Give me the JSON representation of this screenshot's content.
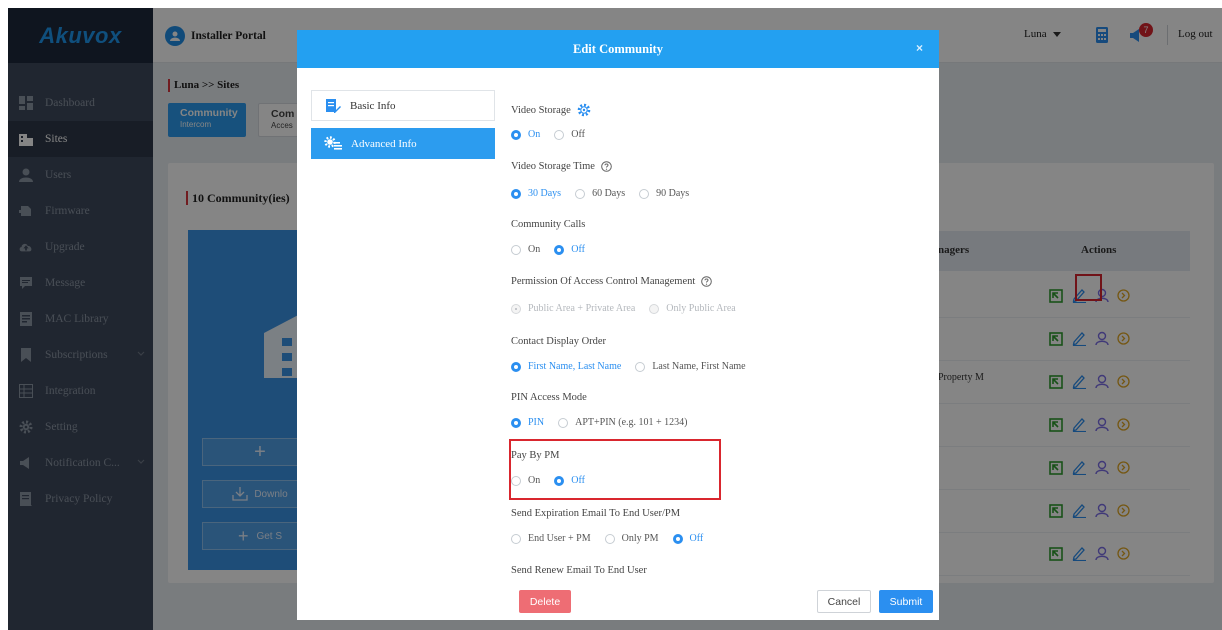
{
  "brand": "Akuvox",
  "sidebar": {
    "items": [
      {
        "label": "Dashboard",
        "icon": "dashboard-icon"
      },
      {
        "label": "Sites",
        "icon": "building-icon",
        "active": true
      },
      {
        "label": "Users",
        "icon": "user-icon"
      },
      {
        "label": "Firmware",
        "icon": "firmware-icon"
      },
      {
        "label": "Upgrade",
        "icon": "cloud-upload-icon"
      },
      {
        "label": "Message",
        "icon": "message-icon"
      },
      {
        "label": "MAC Library",
        "icon": "library-icon"
      },
      {
        "label": "Subscriptions",
        "icon": "bookmark-icon"
      },
      {
        "label": "Integration",
        "icon": "grid-icon"
      },
      {
        "label": "Setting",
        "icon": "gear-icon"
      },
      {
        "label": "Notification C...",
        "icon": "megaphone-icon"
      },
      {
        "label": "Privacy Policy",
        "icon": "document-icon"
      }
    ]
  },
  "header": {
    "portal_title": "Installer Portal",
    "username": "Luna",
    "notification_count": "7",
    "logout": "Log out"
  },
  "background": {
    "breadcrumb": "Luna >> Sites",
    "tab1": {
      "title": "Community",
      "subtitle": "Intercom"
    },
    "tab2": {
      "title": "Com",
      "subtitle": "Acces"
    },
    "community_count": "10 Community(ies)",
    "plus": "+",
    "download_label": "Downlo",
    "get_started_label": "Get S",
    "columns": {
      "managers": "nagers",
      "actions": "Actions"
    },
    "property_manager_text": "Property M"
  },
  "modal": {
    "title": "Edit Community",
    "close": "×",
    "side_basic": "Basic Info",
    "side_advanced": "Advanced Info",
    "sections": {
      "video_storage": {
        "label": "Video Storage",
        "on": "On",
        "off": "Off",
        "selected": "On"
      },
      "video_storage_time": {
        "label": "Video Storage Time",
        "opt1": "30 Days",
        "opt2": "60 Days",
        "opt3": "90 Days",
        "selected": "30 Days"
      },
      "community_calls": {
        "label": "Community Calls",
        "on": "On",
        "off": "Off",
        "selected": "Off"
      },
      "permission": {
        "label": "Permission Of Access Control Management",
        "opt1": "Public Area + Private Area",
        "opt2": "Only Public Area",
        "selected": "Public Area + Private Area"
      },
      "contact_order": {
        "label": "Contact Display Order",
        "opt1": "First Name, Last Name",
        "opt2": "Last Name, First Name",
        "selected": "First Name, Last Name"
      },
      "pin_mode": {
        "label": "PIN Access Mode",
        "opt1": "PIN",
        "opt2": "APT+PIN (e.g. 101 + 1234)",
        "selected": "PIN"
      },
      "pay_by_pm": {
        "label": "Pay By PM",
        "on": "On",
        "off": "Off",
        "selected": "Off"
      },
      "expiration_email": {
        "label": "Send Expiration Email To End User/PM",
        "opt1": "End User + PM",
        "opt2": "Only PM",
        "opt3": "Off",
        "selected": "Off"
      },
      "renew_email": {
        "label": "Send Renew Email To End User"
      }
    },
    "buttons": {
      "delete": "Delete",
      "cancel": "Cancel",
      "submit": "Submit"
    }
  },
  "colors": {
    "primary": "#2b8ff0",
    "header": "#23a0f1",
    "danger": "#ee6d74",
    "highlight": "#d9262e",
    "sidebar": "#3f4a5c",
    "action_edit": "#2f9b2f",
    "action_user": "#7b6ee6",
    "action_more": "#e0a826"
  }
}
